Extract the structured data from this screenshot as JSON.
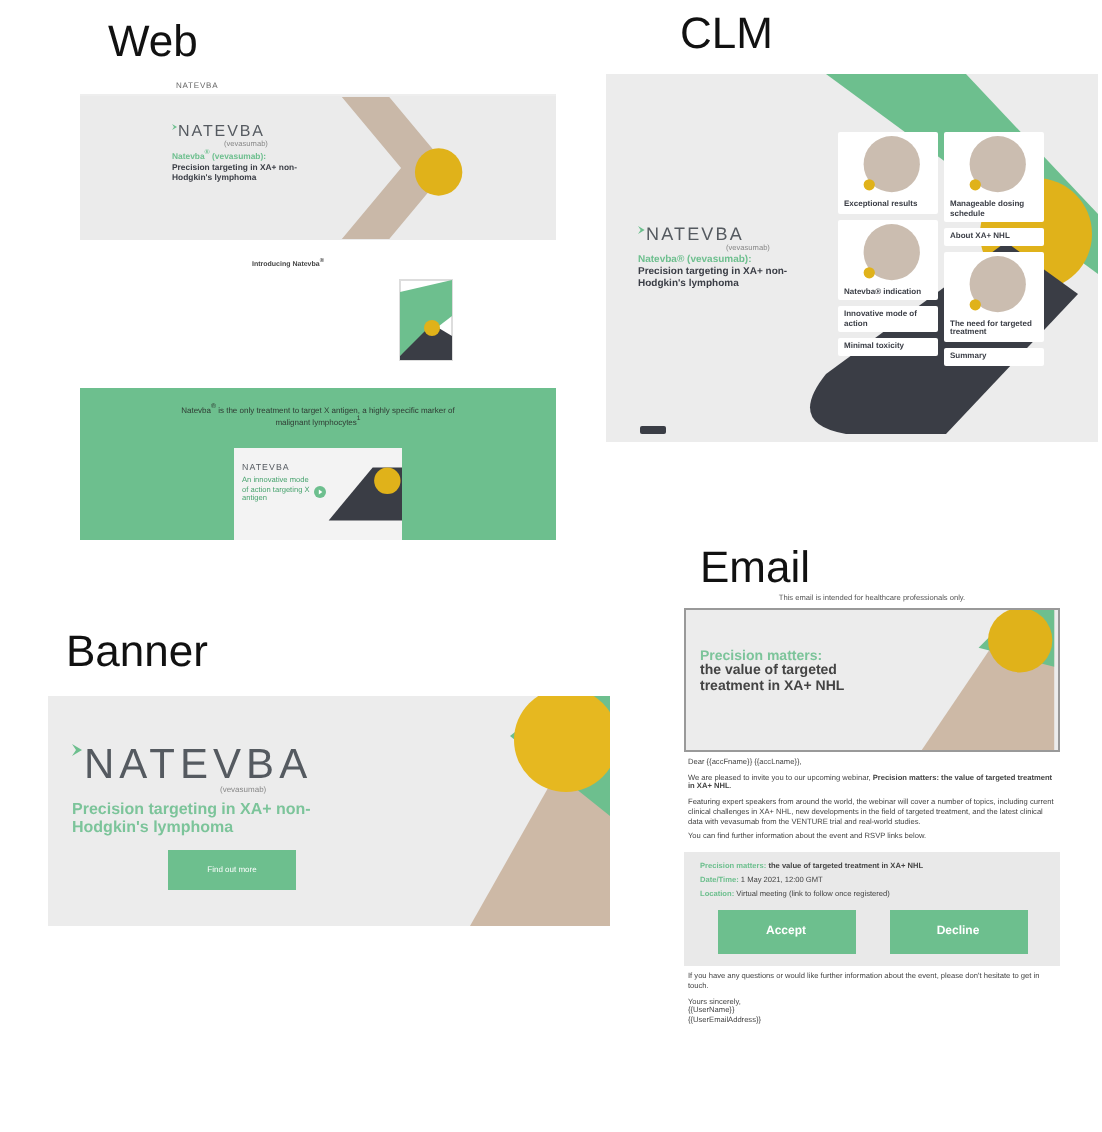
{
  "web": {
    "label": "Web",
    "header_logo": "NATEVBA",
    "hero": {
      "logo": "NATEVBA",
      "logo_sub": "(vevasumab)",
      "title_accent": "Natevba$^{®}$ (vevasumab):",
      "title": "Precision targeting in XA+ non-Hodgkin's lymphoma"
    },
    "intro_heading": "Introducing Natevba$^{®}$",
    "statement": "Natevba$^{®}$ is the only treatment to target X antigen, a highly specific marker of malignant lymphocytes$^{1}$",
    "video": {
      "logo": "NATEVBA",
      "caption": "An innovative mode of action targeting X antigen"
    }
  },
  "clm": {
    "label": "CLM",
    "logo": "NATEVBA",
    "logo_sub": "(vevasumab)",
    "title_accent": "Natevba® (vevasumab):",
    "title": "Precision targeting in XA+ non-Hodgkin's lymphoma",
    "tile_columns": [
      [
        {
          "kind": "photo",
          "label": "Exceptional results"
        },
        {
          "kind": "photo",
          "label": "Natevba® indication"
        },
        {
          "kind": "text",
          "label": "Innovative mode of action"
        },
        {
          "kind": "text",
          "label": "Minimal toxicity"
        }
      ],
      [
        {
          "kind": "photo",
          "label": "Manageable dosing schedule"
        },
        {
          "kind": "text",
          "label": "About XA+ NHL"
        },
        {
          "kind": "photo",
          "label": "The need for targeted treatment"
        },
        {
          "kind": "text",
          "label": "Summary"
        }
      ]
    ]
  },
  "banner": {
    "label": "Banner",
    "logo": "NATEVBA",
    "logo_sub": "(vevasumab)",
    "title": "Precision targeting in XA+ non-Hodgkin's lymphoma",
    "button": "Find out more"
  },
  "email": {
    "label": "Email",
    "disclaimer": "This email is intended for healthcare professionals only.",
    "hero": {
      "title_accent": "Precision matters:",
      "title": "the value of targeted treatment in XA+ NHL"
    },
    "paragraphs": [
      "Dear {{accFname}} {{accLname}},",
      "We are pleased to invite you to our upcoming webinar, **Precision matters: the value of targeted treatment in XA+ NHL**.",
      "Featuring expert speakers from around the world, the webinar will cover a number of topics, including current clinical challenges in XA+ NHL, new developments in the field of targeted treatment, and the latest clinical data with vevasumab from the VENTURE trial and real-world studies.",
      "You can find further information about the event and RSVP links below."
    ],
    "event": {
      "title_accent": "Precision matters:",
      "title": "the value of targeted treatment in XA+ NHL",
      "details": [
        {
          "label": "Date/Time:",
          "value": "1 May 2021, 12:00 GMT"
        },
        {
          "label": "Location:",
          "value": "Virtual meeting (link to follow once registered)"
        }
      ],
      "buttons": [
        "Accept",
        "Decline"
      ]
    },
    "closing": "If you have any questions or would like further information about the event, please don't hesitate to get in touch.",
    "signature": [
      "Yours sincerely,",
      "{{UserName}}",
      "{{UserEmailAddress}}"
    ]
  }
}
